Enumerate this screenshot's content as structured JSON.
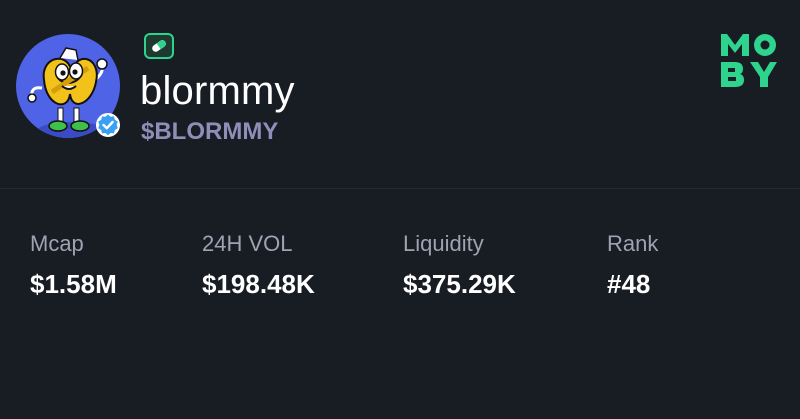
{
  "token": {
    "name": "blormmy",
    "symbol": "$BLORMMY",
    "verified": true,
    "avatar_icon": "cartoon-mascot-avatar",
    "badge_icon": "pill-icon"
  },
  "brand": {
    "logo_icon": "moby-logo",
    "logo_text": "MOBY",
    "accent_color": "#2ed38e"
  },
  "stats": [
    {
      "label": "Mcap",
      "value": "$1.58M"
    },
    {
      "label": "24H VOL",
      "value": "$198.48K"
    },
    {
      "label": "Liquidity",
      "value": "$375.29K"
    },
    {
      "label": "Rank",
      "value": "#48"
    }
  ],
  "colors": {
    "background": "#181c23",
    "avatar_bg": "#4f63e6",
    "symbol": "#8e8fb9",
    "label": "#9ea3b3",
    "verified": "#3aa0f3"
  }
}
